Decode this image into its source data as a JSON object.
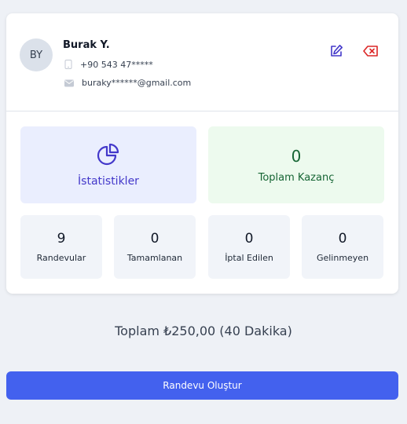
{
  "profile": {
    "initials": "BY",
    "name": "Burak Y.",
    "phone": "+90 543 47*****",
    "email": "buraky******@gmail.com",
    "phone_icon": "phone-icon",
    "email_icon": "mail-icon",
    "edit_icon": "pencil-icon",
    "delete_icon": "backspace-x-icon"
  },
  "stats": {
    "statistics_label": "İstatistikler",
    "statistics_icon": "pie-chart-icon",
    "earnings_value": "0",
    "earnings_label": "Toplam Kazanç",
    "counters": [
      {
        "value": "9",
        "label": "Randevular"
      },
      {
        "value": "0",
        "label": "Tamamlanan"
      },
      {
        "value": "0",
        "label": "İptal Edilen"
      },
      {
        "value": "0",
        "label": "Gelinmeyen"
      }
    ]
  },
  "summary": {
    "total_text": "Toplam ₺250,00 (40 Dakika)"
  },
  "actions": {
    "create_label": "Randevu Oluştur"
  },
  "colors": {
    "accent": "#4361ee",
    "stats_bg": "#eaeefe",
    "earnings_bg": "#edfaee",
    "delete": "#dc2626"
  }
}
